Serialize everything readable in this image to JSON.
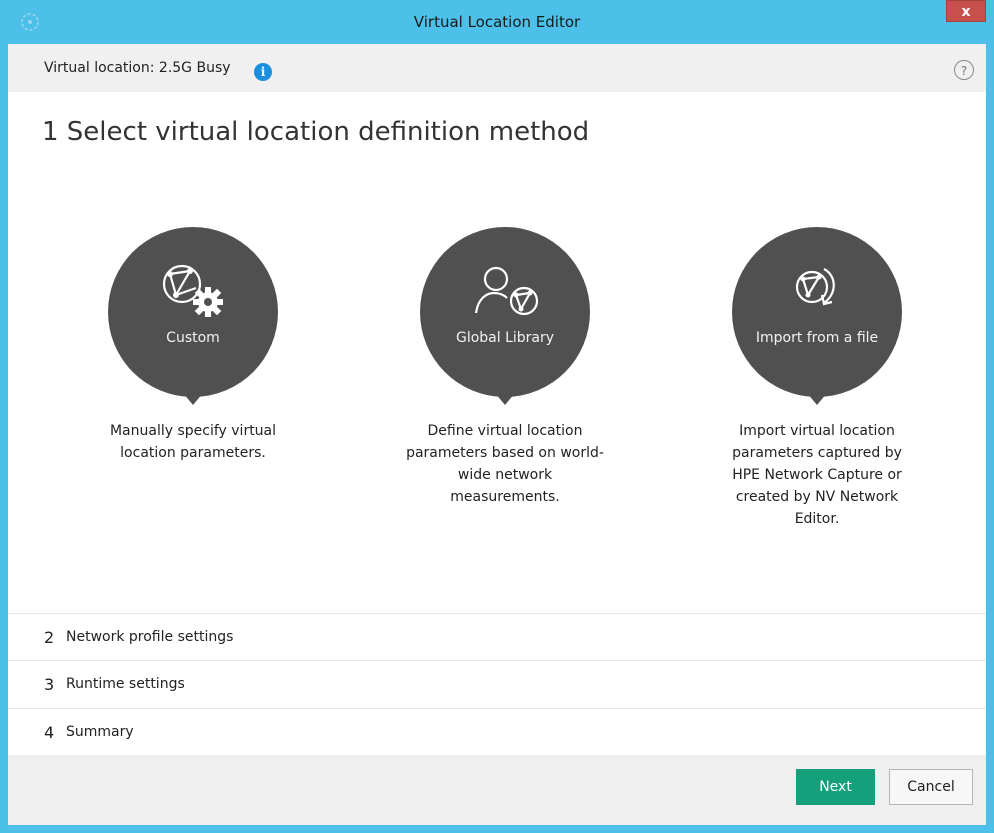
{
  "window": {
    "title": "Virtual Location Editor",
    "close_label": "x",
    "app_icon": "network-globe-icon"
  },
  "info_bar": {
    "virtual_location_label": "Virtual location: 2.5G Busy",
    "info_icon": "info-icon",
    "info_icon_glyph": "i",
    "help_icon": "help-icon",
    "help_icon_glyph": "?"
  },
  "step1": {
    "title": "1 Select virtual location definition method",
    "methods": [
      {
        "label": "Custom",
        "icon": "globe-gear-icon",
        "description": "Manually specify virtual location parameters."
      },
      {
        "label": "Global Library",
        "icon": "user-globe-icon",
        "description": "Define virtual location parameters based on world-wide network measurements."
      },
      {
        "label": "Import from a file",
        "icon": "globe-import-icon",
        "description": "Import virtual location parameters captured by HPE Network Capture or created by NV Network Editor."
      }
    ]
  },
  "steps": [
    {
      "number": "2",
      "label": "Network profile settings"
    },
    {
      "number": "3",
      "label": "Runtime settings"
    },
    {
      "number": "4",
      "label": "Summary"
    }
  ],
  "footer": {
    "next_label": "Next",
    "cancel_label": "Cancel"
  },
  "colors": {
    "titlebar": "#4cc0e8",
    "bubble": "#505050",
    "primary_button": "#13a07a",
    "info_icon": "#1b8fde",
    "close_button": "#c7504a"
  }
}
